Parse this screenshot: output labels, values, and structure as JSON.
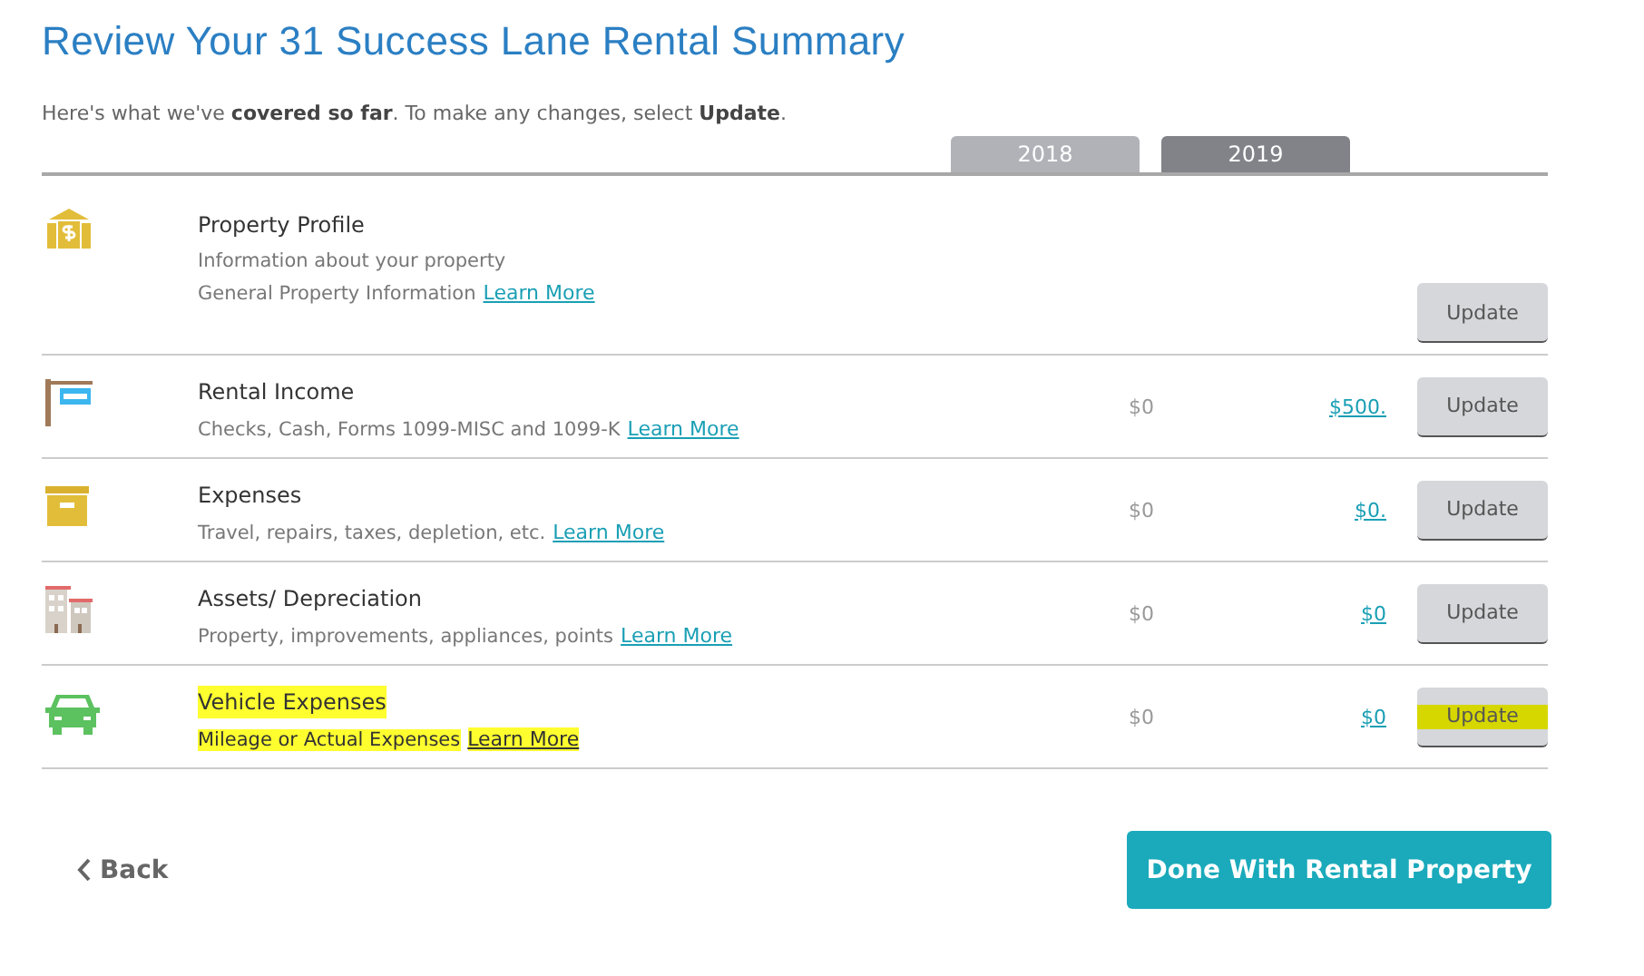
{
  "title": "Review Your 31 Success Lane Rental Summary",
  "intro": "Here's what we've **covered so far**. To make any changes, select **Update**.",
  "year_tabs": [
    {
      "label": "2018",
      "selected": false
    },
    {
      "label": "2019",
      "selected": true
    }
  ],
  "rows": [
    {
      "title": "Property Profile",
      "lines": [
        "Information about your property",
        "General Property Information"
      ],
      "link": "Learn More",
      "value_2018": null,
      "value_2019": null,
      "button": "Update",
      "highlighted": false
    },
    {
      "title": "Rental Income",
      "lines": [
        "Checks, Cash, Forms 1099-MISC and 1099-K"
      ],
      "link": "Learn More",
      "value_2018": "$0",
      "value_2019": "$500.",
      "button": "Update",
      "highlighted": false
    },
    {
      "title": "Expenses",
      "lines": [
        "Travel, repairs, taxes, depletion, etc."
      ],
      "link": "Learn More",
      "value_2018": "$0",
      "value_2019": "$0.",
      "button": "Update",
      "highlighted": false
    },
    {
      "title": "Assets/ Depreciation",
      "lines": [
        "Property, improvements, appliances, points"
      ],
      "link": "Learn More",
      "value_2018": "$0",
      "value_2019": "$0",
      "button": "Update",
      "highlighted": false
    },
    {
      "title": "Vehicle Expenses",
      "lines": [
        "Mileage or Actual Expenses"
      ],
      "link": "Learn More",
      "value_2018": "$0",
      "value_2019": "$0",
      "button": "Update",
      "highlighted": true
    }
  ],
  "back": "Back",
  "done": "Done With Rental Property"
}
